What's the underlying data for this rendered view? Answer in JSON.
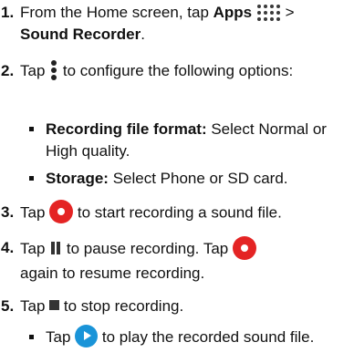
{
  "steps": [
    {
      "number": "1.",
      "text_a": "From the Home screen, tap ",
      "bold_a": "Apps",
      "text_b": " > ",
      "bold_b": "Sound Recorder",
      "text_c": "."
    },
    {
      "number": "2.",
      "text_a": "Tap ",
      "text_b": " to configure the following options:",
      "bullets": [
        {
          "label": "Recording file format:",
          "text": " Select Normal or High quality."
        },
        {
          "label": "Storage:",
          "text": " Select Phone or SD card."
        }
      ]
    },
    {
      "number": "3.",
      "text_a": "Tap ",
      "text_b": " to start recording a sound file."
    },
    {
      "number": "4.",
      "text_a": "Tap ",
      "text_b": " to pause recording. Tap ",
      "text_c": " again to resume recording."
    },
    {
      "number": "5.",
      "text_a": "Tap ",
      "text_b": " to stop recording.",
      "bullets": [
        {
          "text_a": "Tap ",
          "text_b": " to play the recorded sound file."
        }
      ]
    }
  ],
  "icons": {
    "apps": "apps-grid-icon",
    "menu": "more-vertical-icon",
    "record": "record-icon",
    "pause": "pause-icon",
    "stop": "stop-icon",
    "play": "play-icon"
  },
  "colors": {
    "record": "#e42424",
    "play": "#1a94d8",
    "text": "#111111"
  }
}
